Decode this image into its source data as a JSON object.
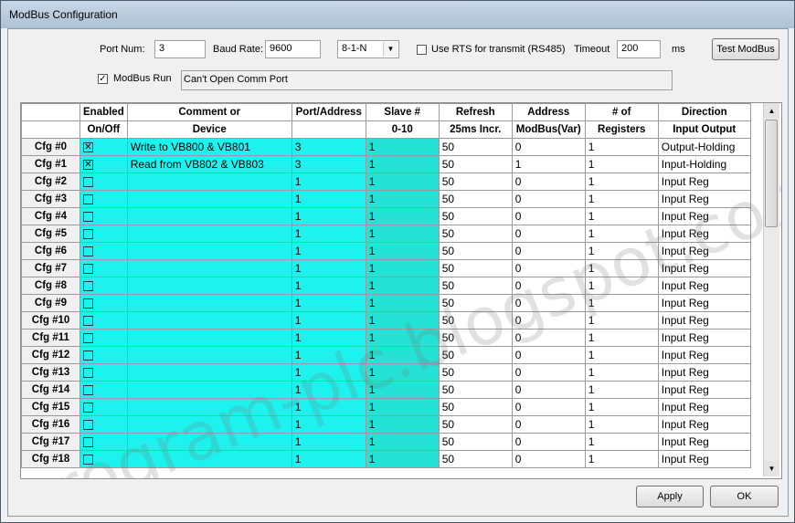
{
  "window": {
    "title": "ModBus Configuration"
  },
  "settings": {
    "port_num_label": "Port Num:",
    "port_num_value": "3",
    "baud_rate_label": "Baud Rate:",
    "baud_rate_value": "9600",
    "format_value": "8-1-N",
    "use_rts_label": "Use RTS for transmit (RS485)",
    "use_rts_checked": false,
    "timeout_label": "Timeout",
    "timeout_value": "200",
    "timeout_unit": "ms",
    "test_button": "Test ModBus",
    "modbus_run_label": "ModBus Run",
    "modbus_run_checked": true,
    "status_text": "Can't Open Comm Port"
  },
  "grid": {
    "headers_top": [
      "",
      "Enabled",
      "Comment or",
      "Port/Address",
      "Slave #",
      "Refresh",
      "Address",
      "# of",
      "Direction"
    ],
    "headers_bottom": [
      "",
      "On/Off",
      "Device",
      "",
      "0-10",
      "25ms Incr.",
      "ModBus(Var)",
      "Registers",
      "Input Output"
    ],
    "rows": [
      {
        "cfg": "Cfg #0",
        "enabled": true,
        "comment": "Write to VB800 & VB801",
        "port": "3",
        "slave": "1",
        "refresh": "50",
        "address": "0",
        "registers": "1",
        "direction": "Output-Holding"
      },
      {
        "cfg": "Cfg #1",
        "enabled": true,
        "comment": "Read from VB802 & VB803",
        "port": "3",
        "slave": "1",
        "refresh": "50",
        "address": "1",
        "registers": "1",
        "direction": "Input-Holding"
      },
      {
        "cfg": "Cfg #2",
        "enabled": false,
        "comment": "",
        "port": "1",
        "slave": "1",
        "refresh": "50",
        "address": "0",
        "registers": "1",
        "direction": "Input Reg"
      },
      {
        "cfg": "Cfg #3",
        "enabled": false,
        "comment": "",
        "port": "1",
        "slave": "1",
        "refresh": "50",
        "address": "0",
        "registers": "1",
        "direction": "Input Reg"
      },
      {
        "cfg": "Cfg #4",
        "enabled": false,
        "comment": "",
        "port": "1",
        "slave": "1",
        "refresh": "50",
        "address": "0",
        "registers": "1",
        "direction": "Input Reg"
      },
      {
        "cfg": "Cfg #5",
        "enabled": false,
        "comment": "",
        "port": "1",
        "slave": "1",
        "refresh": "50",
        "address": "0",
        "registers": "1",
        "direction": "Input Reg"
      },
      {
        "cfg": "Cfg #6",
        "enabled": false,
        "comment": "",
        "port": "1",
        "slave": "1",
        "refresh": "50",
        "address": "0",
        "registers": "1",
        "direction": "Input Reg"
      },
      {
        "cfg": "Cfg #7",
        "enabled": false,
        "comment": "",
        "port": "1",
        "slave": "1",
        "refresh": "50",
        "address": "0",
        "registers": "1",
        "direction": "Input Reg"
      },
      {
        "cfg": "Cfg #8",
        "enabled": false,
        "comment": "",
        "port": "1",
        "slave": "1",
        "refresh": "50",
        "address": "0",
        "registers": "1",
        "direction": "Input Reg"
      },
      {
        "cfg": "Cfg #9",
        "enabled": false,
        "comment": "",
        "port": "1",
        "slave": "1",
        "refresh": "50",
        "address": "0",
        "registers": "1",
        "direction": "Input Reg"
      },
      {
        "cfg": "Cfg #10",
        "enabled": false,
        "comment": "",
        "port": "1",
        "slave": "1",
        "refresh": "50",
        "address": "0",
        "registers": "1",
        "direction": "Input Reg"
      },
      {
        "cfg": "Cfg #11",
        "enabled": false,
        "comment": "",
        "port": "1",
        "slave": "1",
        "refresh": "50",
        "address": "0",
        "registers": "1",
        "direction": "Input Reg"
      },
      {
        "cfg": "Cfg #12",
        "enabled": false,
        "comment": "",
        "port": "1",
        "slave": "1",
        "refresh": "50",
        "address": "0",
        "registers": "1",
        "direction": "Input Reg"
      },
      {
        "cfg": "Cfg #13",
        "enabled": false,
        "comment": "",
        "port": "1",
        "slave": "1",
        "refresh": "50",
        "address": "0",
        "registers": "1",
        "direction": "Input Reg"
      },
      {
        "cfg": "Cfg #14",
        "enabled": false,
        "comment": "",
        "port": "1",
        "slave": "1",
        "refresh": "50",
        "address": "0",
        "registers": "1",
        "direction": "Input Reg"
      },
      {
        "cfg": "Cfg #15",
        "enabled": false,
        "comment": "",
        "port": "1",
        "slave": "1",
        "refresh": "50",
        "address": "0",
        "registers": "1",
        "direction": "Input Reg"
      },
      {
        "cfg": "Cfg #16",
        "enabled": false,
        "comment": "",
        "port": "1",
        "slave": "1",
        "refresh": "50",
        "address": "0",
        "registers": "1",
        "direction": "Input Reg"
      },
      {
        "cfg": "Cfg #17",
        "enabled": false,
        "comment": "",
        "port": "1",
        "slave": "1",
        "refresh": "50",
        "address": "0",
        "registers": "1",
        "direction": "Input Reg"
      },
      {
        "cfg": "Cfg #18",
        "enabled": false,
        "comment": "",
        "port": "1",
        "slave": "1",
        "refresh": "50",
        "address": "0",
        "registers": "1",
        "direction": "Input Reg"
      }
    ]
  },
  "watermark": "program-plc.blogspot.com",
  "buttons": {
    "apply": "Apply",
    "ok": "OK"
  },
  "colors": {
    "cyan": "#1ef2ee",
    "teal": "#24e3d6"
  }
}
